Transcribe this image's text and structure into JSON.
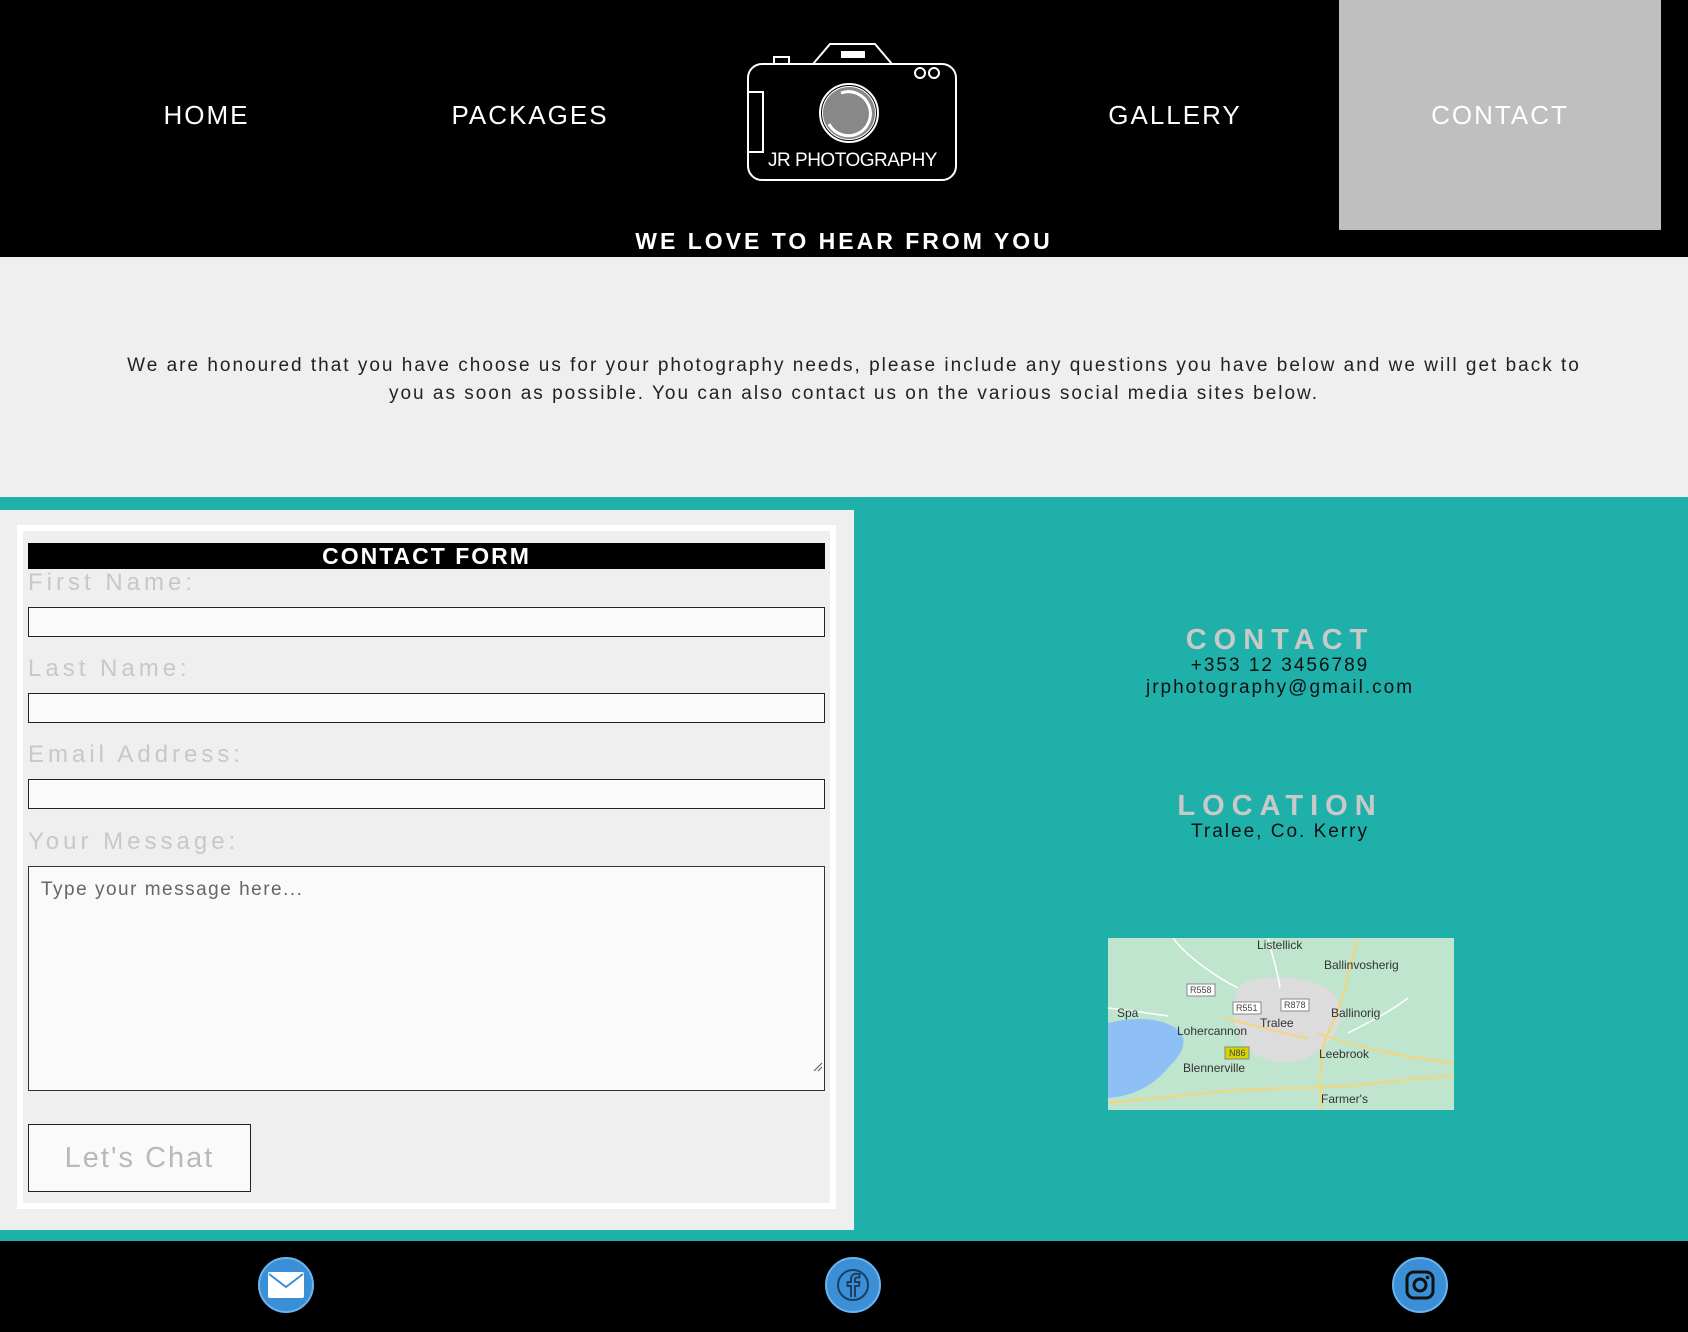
{
  "nav": {
    "home": "HOME",
    "packages": "PACKAGES",
    "gallery": "GALLERY",
    "contact": "CONTACT",
    "logo_text": "JR PHOTOGRAPHY",
    "active_bg": "#bfbfbf"
  },
  "tagline": "WE LOVE TO HEAR FROM YOU",
  "intro": "We are honoured that you have choose us for your photography needs, please include any questions you have below and we will get back to you as soon as possible. You can also contact us on the various social media sites below.",
  "form": {
    "title": "CONTACT FORM",
    "first_name_label": "First Name:",
    "last_name_label": "Last Name:",
    "email_label": "Email Address:",
    "message_label": "Your Message:",
    "message_placeholder": "Type your message here...",
    "submit_label": "Let's Chat"
  },
  "contact": {
    "heading": "CONTACT",
    "phone": "+353 12 3456789",
    "email": "jrphotography@gmail.com"
  },
  "location": {
    "heading": "LOCATION",
    "address": "Tralee, Co. Kerry"
  },
  "map": {
    "places": [
      "Listellick",
      "Ballinvosherig",
      "Spa",
      "Ballinorig",
      "Lohercannon",
      "Tralee",
      "Blennerville",
      "Leebrook",
      "Farmer's"
    ],
    "roads": [
      "R558",
      "R551",
      "R878",
      "N86"
    ]
  },
  "footer": {
    "icons": [
      "mail-icon",
      "facebook-icon",
      "instagram-icon"
    ]
  },
  "colors": {
    "teal": "#20b0aa",
    "nav_bg": "#000000",
    "intro_bg": "#efefef",
    "social": "#3a8fd6"
  }
}
